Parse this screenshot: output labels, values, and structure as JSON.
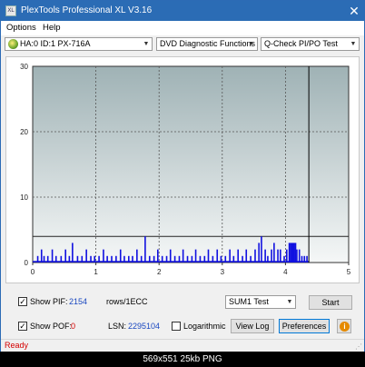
{
  "window": {
    "title": "PlexTools Professional XL V3.16",
    "icon_label": "XL"
  },
  "menu": {
    "options_label": "Options",
    "help_label": "Help"
  },
  "toolbar": {
    "drive": "HA:0 ID:1  PX-716A",
    "function": "DVD Diagnostic Functions",
    "test": "Q-Check PI/PO Test"
  },
  "chart_data": {
    "type": "bar",
    "x_ticks": [
      "0",
      "1",
      "2",
      "3",
      "4",
      "5"
    ],
    "y_ticks": [
      "0",
      "10",
      "20",
      "30"
    ],
    "xlim": [
      0,
      5
    ],
    "ylim": [
      0,
      30
    ],
    "grid": true,
    "threshold_value": 4,
    "end_marker_x": 4.37,
    "bar_color": "#1010e0",
    "background_gradient": [
      "#9fb2b5",
      "#f5f7f7"
    ],
    "values": [
      {
        "x": 0.08,
        "y": 1
      },
      {
        "x": 0.14,
        "y": 2
      },
      {
        "x": 0.18,
        "y": 1
      },
      {
        "x": 0.24,
        "y": 1
      },
      {
        "x": 0.31,
        "y": 2
      },
      {
        "x": 0.37,
        "y": 1
      },
      {
        "x": 0.45,
        "y": 1
      },
      {
        "x": 0.52,
        "y": 2
      },
      {
        "x": 0.58,
        "y": 1
      },
      {
        "x": 0.63,
        "y": 3
      },
      {
        "x": 0.71,
        "y": 1
      },
      {
        "x": 0.78,
        "y": 1
      },
      {
        "x": 0.85,
        "y": 2
      },
      {
        "x": 0.92,
        "y": 1
      },
      {
        "x": 0.98,
        "y": 1
      },
      {
        "x": 1.05,
        "y": 1
      },
      {
        "x": 1.12,
        "y": 2
      },
      {
        "x": 1.18,
        "y": 1
      },
      {
        "x": 1.25,
        "y": 1
      },
      {
        "x": 1.32,
        "y": 1
      },
      {
        "x": 1.39,
        "y": 2
      },
      {
        "x": 1.45,
        "y": 1
      },
      {
        "x": 1.52,
        "y": 1
      },
      {
        "x": 1.58,
        "y": 1
      },
      {
        "x": 1.65,
        "y": 2
      },
      {
        "x": 1.72,
        "y": 1
      },
      {
        "x": 1.78,
        "y": 4
      },
      {
        "x": 1.85,
        "y": 1
      },
      {
        "x": 1.92,
        "y": 1
      },
      {
        "x": 1.98,
        "y": 2
      },
      {
        "x": 2.05,
        "y": 1
      },
      {
        "x": 2.12,
        "y": 1
      },
      {
        "x": 2.18,
        "y": 2
      },
      {
        "x": 2.25,
        "y": 1
      },
      {
        "x": 2.32,
        "y": 1
      },
      {
        "x": 2.38,
        "y": 2
      },
      {
        "x": 2.45,
        "y": 1
      },
      {
        "x": 2.52,
        "y": 1
      },
      {
        "x": 2.58,
        "y": 2
      },
      {
        "x": 2.65,
        "y": 1
      },
      {
        "x": 2.72,
        "y": 1
      },
      {
        "x": 2.78,
        "y": 2
      },
      {
        "x": 2.85,
        "y": 1
      },
      {
        "x": 2.92,
        "y": 2
      },
      {
        "x": 2.98,
        "y": 1
      },
      {
        "x": 3.05,
        "y": 1
      },
      {
        "x": 3.12,
        "y": 2
      },
      {
        "x": 3.18,
        "y": 1
      },
      {
        "x": 3.25,
        "y": 2
      },
      {
        "x": 3.32,
        "y": 1
      },
      {
        "x": 3.38,
        "y": 2
      },
      {
        "x": 3.45,
        "y": 1
      },
      {
        "x": 3.52,
        "y": 2
      },
      {
        "x": 3.58,
        "y": 3
      },
      {
        "x": 3.62,
        "y": 4
      },
      {
        "x": 3.68,
        "y": 2
      },
      {
        "x": 3.72,
        "y": 1
      },
      {
        "x": 3.78,
        "y": 2
      },
      {
        "x": 3.82,
        "y": 3
      },
      {
        "x": 3.88,
        "y": 2
      },
      {
        "x": 3.92,
        "y": 2
      },
      {
        "x": 3.98,
        "y": 1
      },
      {
        "x": 4.02,
        "y": 2
      },
      {
        "x": 4.06,
        "y": 3
      },
      {
        "x": 4.08,
        "y": 3
      },
      {
        "x": 4.1,
        "y": 3
      },
      {
        "x": 4.12,
        "y": 3
      },
      {
        "x": 4.14,
        "y": 3
      },
      {
        "x": 4.16,
        "y": 3
      },
      {
        "x": 4.18,
        "y": 2
      },
      {
        "x": 4.22,
        "y": 2
      },
      {
        "x": 4.26,
        "y": 1
      },
      {
        "x": 4.3,
        "y": 1
      },
      {
        "x": 4.34,
        "y": 1
      }
    ]
  },
  "controls": {
    "show_pif_label": "Show PIF:",
    "show_pif_checked": "✓",
    "pif_value": "2154",
    "rows_label": "rows/1ECC",
    "show_pof_label": "Show POF:",
    "show_pof_checked": "✓",
    "pof_value": "0",
    "lsn_label": "LSN:",
    "lsn_value": "2295104",
    "logarithmic_label": "Logarithmic",
    "sum_select": "SUM1 Test",
    "start_label": "Start",
    "view_log_label": "View Log",
    "preferences_label": "Preferences",
    "info_label": "i"
  },
  "status": {
    "text": "Ready"
  },
  "caption": {
    "text": "569x551  25kb  PNG"
  }
}
